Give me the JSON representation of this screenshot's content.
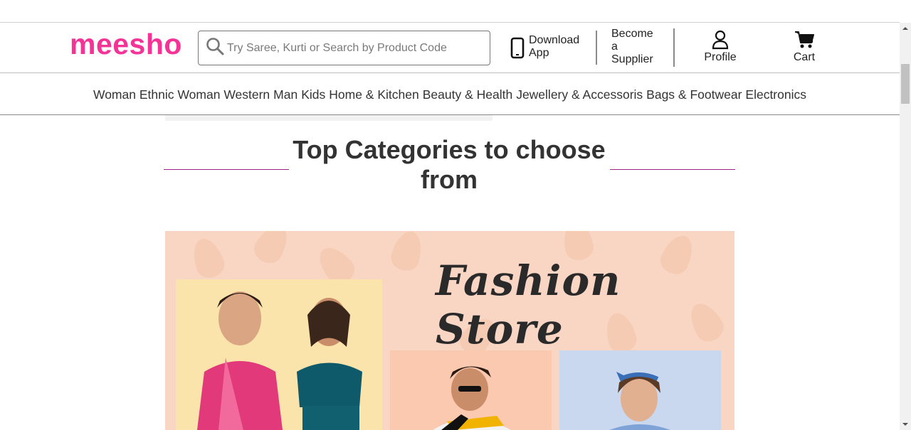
{
  "brand": {
    "logo_text": "meesho",
    "color": "#f43397"
  },
  "search": {
    "placeholder": "Try Saree, Kurti or Search by Product Code",
    "icon": "search-icon"
  },
  "header": {
    "download": {
      "label": "Download App",
      "line1": "Download",
      "line2": "App",
      "icon": "mobile-phone-icon"
    },
    "supplier": {
      "line1": "Become",
      "line2": "a",
      "line3": "Supplier"
    },
    "profile": {
      "label": "Profile",
      "icon": "user-icon"
    },
    "cart": {
      "label": "Cart",
      "icon": "cart-icon"
    }
  },
  "nav": {
    "items": [
      {
        "label": "Woman Ethnic"
      },
      {
        "label": "Woman Western"
      },
      {
        "label": "Man"
      },
      {
        "label": "Kids"
      },
      {
        "label": "Home & Kitchen"
      },
      {
        "label": "Beauty & Health"
      },
      {
        "label": "Jewellery & Accessoris"
      },
      {
        "label": "Bags & Footwear"
      },
      {
        "label": "Electronics"
      }
    ]
  },
  "main": {
    "heading": "Top Categories to choose from",
    "accent_line_color": "#9f2089"
  },
  "banner": {
    "title": "Fashion Store",
    "background": "#f9d6c4"
  }
}
